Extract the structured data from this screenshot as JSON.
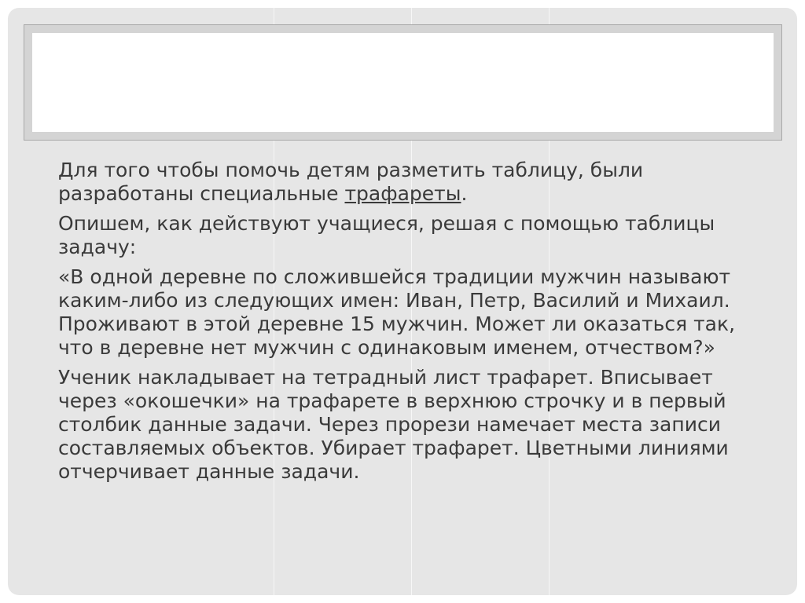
{
  "slide": {
    "title": "",
    "paragraphs": [
      {
        "before": "Для того чтобы помочь детям разметить таблицу, были разработаны специальные ",
        "link": "трафареты",
        "after": "."
      },
      {
        "text": "Опишем, как действуют учащиеся, решая с помощью таблицы задачу:"
      },
      {
        "text": "«В одной деревне по сложившейся традиции мужчин называют каким-либо из следующих имен: Иван, Петр, Василий и Михаил. Проживают в этой деревне 15 мужчин. Может ли оказаться так, что в деревне нет мужчин с одинаковым именем, отчеством?»"
      },
      {
        "text": "Ученик накладывает на тетрадный лист трафарет. Вписывает через «окошечки» на трафарете в верхнюю строчку и в первый столбик данные задачи. Через прорези намечает места записи составляемых объектов. Убирает трафарет. Цветными линиями отчерчивает данные задачи."
      }
    ]
  },
  "colors": {
    "background": "#e6e6e6",
    "text": "#3a3a3a",
    "title_box": "#ffffff"
  }
}
